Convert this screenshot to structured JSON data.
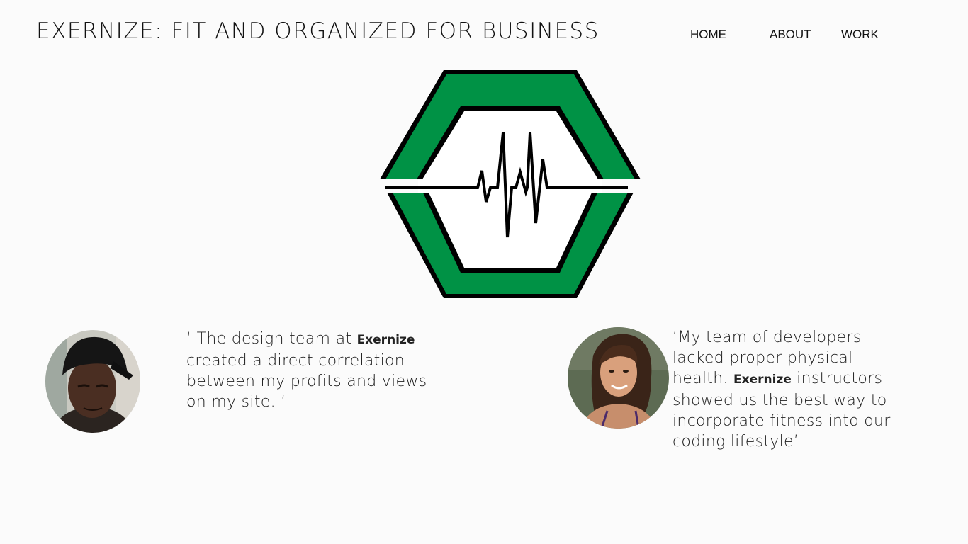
{
  "header": {
    "title": "EXERNIZE: FIT AND ORGANIZED FOR BUSINESS"
  },
  "nav": {
    "items": [
      {
        "label": "HOME"
      },
      {
        "label": "ABOUT"
      },
      {
        "label": "WORK"
      }
    ]
  },
  "logo": {
    "icon": "heartbeat-hexagon-logo",
    "colors": {
      "green": "#009245",
      "black": "#000000",
      "white": "#ffffff"
    }
  },
  "testimonials": [
    {
      "avatar_icon": "man-with-cap-avatar",
      "quote_open": "‘ The design team at ",
      "brand": "Exernize",
      "quote_rest": " created a direct correlation between my profits and views on my site. ’"
    },
    {
      "avatar_icon": "woman-avatar",
      "quote_open": "‘My team of developers lacked proper physical health. ",
      "brand": "Exernize",
      "quote_rest": " instructors showed us the best way to incorporate fitness into our coding lifestyle’"
    }
  ]
}
